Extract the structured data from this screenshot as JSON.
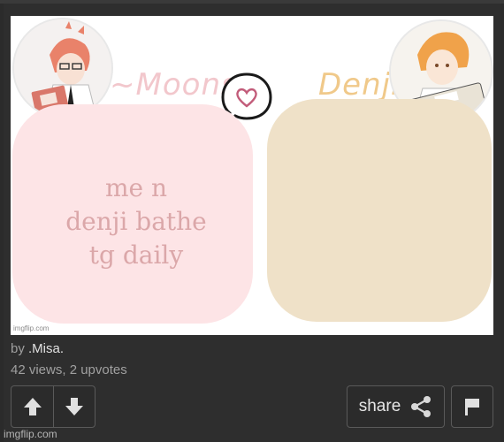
{
  "meme": {
    "left_name": "Moons",
    "right_name": "Denji",
    "left_text": "me n\ndenji bathe\ntg daily",
    "inner_watermark": "imgflip.com",
    "colors": {
      "left_panel": "#fde4e6",
      "right_panel": "#efe1c8",
      "left_name": "#f2c7cc",
      "right_name": "#f0c98a",
      "text": "#dba7a9"
    }
  },
  "post": {
    "by_prefix": "by",
    "author": ".Misa.",
    "stats": "42 views, 2 upvotes"
  },
  "actions": {
    "upvote_icon": "arrow-up-icon",
    "downvote_icon": "arrow-down-icon",
    "share_label": "share",
    "share_icon": "share-icon",
    "flag_icon": "flag-icon"
  },
  "footer": {
    "watermark": "imgflip.com"
  }
}
